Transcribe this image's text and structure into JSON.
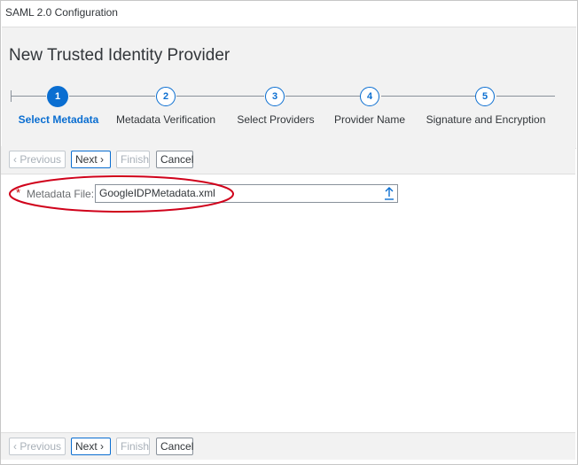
{
  "window": {
    "title": "SAML 2.0 Configuration"
  },
  "header": {
    "title": "New Trusted Identity Provider"
  },
  "wizard": {
    "current_step": 1,
    "steps": [
      {
        "number": "1",
        "label": "Select Metadata"
      },
      {
        "number": "2",
        "label": "Metadata Verification"
      },
      {
        "number": "3",
        "label": "Select Providers"
      },
      {
        "number": "4",
        "label": "Provider Name"
      },
      {
        "number": "5",
        "label": "Signature and Encryption"
      }
    ]
  },
  "toolbar": {
    "previous_label": "Previous",
    "next_label": "Next",
    "finish_label": "Finish",
    "cancel_label": "Cancel"
  },
  "form": {
    "required_marker": "*",
    "metadata_file_label": "Metadata File:",
    "metadata_file_value": "GoogleIDPMetadata.xml"
  },
  "icons": {
    "previous": "chevron-left-icon",
    "next": "chevron-right-icon",
    "upload": "upload-icon"
  },
  "colors": {
    "accent": "#0a6ed1",
    "highlight": "#d0021b",
    "required": "#bb0000"
  }
}
